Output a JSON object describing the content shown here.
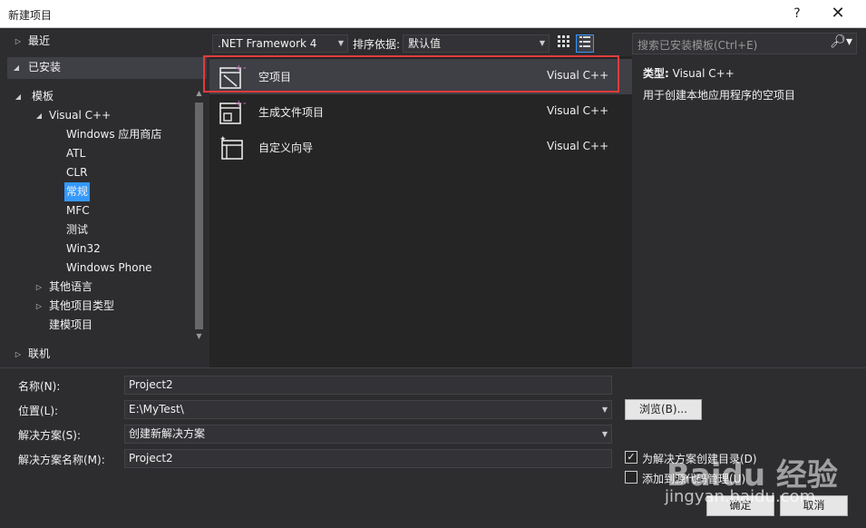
{
  "window": {
    "title": "新建项目",
    "help": "?",
    "close": "✕"
  },
  "tree": {
    "recent": "最近",
    "installed": "已安装",
    "templates": "模板",
    "visual_cpp": "Visual C++",
    "children": [
      "Windows 应用商店",
      "ATL",
      "CLR",
      "常规",
      "MFC",
      "测试",
      "Win32",
      "Windows Phone"
    ],
    "other_languages": "其他语言",
    "other_project_types": "其他项目类型",
    "modeling_projects": "建模项目",
    "online": "联机"
  },
  "toolbar": {
    "framework": ".NET Framework 4",
    "sort_label": "排序依据:",
    "sort_value": "默认值"
  },
  "search": {
    "placeholder": "搜索已安装模板(Ctrl+E)"
  },
  "templates": [
    {
      "name": "空项目",
      "lang": "Visual C++",
      "icon": "empty-project-icon"
    },
    {
      "name": "生成文件项目",
      "lang": "Visual C++",
      "icon": "makefile-project-icon"
    },
    {
      "name": "自定义向导",
      "lang": "Visual C++",
      "icon": "custom-wizard-icon"
    }
  ],
  "info": {
    "type_label": "类型:",
    "type_value": "Visual C++",
    "description": "用于创建本地应用程序的空项目"
  },
  "form": {
    "name_label": "名称(N):",
    "name_value": "Project2",
    "location_label": "位置(L):",
    "location_value": "E:\\MyTest\\",
    "solution_label": "解决方案(S):",
    "solution_value": "创建新解决方案",
    "solution_name_label": "解决方案名称(M):",
    "solution_name_value": "Project2",
    "browse": "浏览(B)...",
    "create_dir": "为解决方案创建目录(D)",
    "add_source_control": "添加到源代码管理(U)",
    "ok": "确定",
    "cancel": "取消"
  },
  "watermark": {
    "brand": "Baidu 经验",
    "url": "jingyan.baidu.com"
  },
  "colors": {
    "selection": "#3399ff",
    "highlight_border": "#e03c3c",
    "background": "#2d2d30"
  }
}
